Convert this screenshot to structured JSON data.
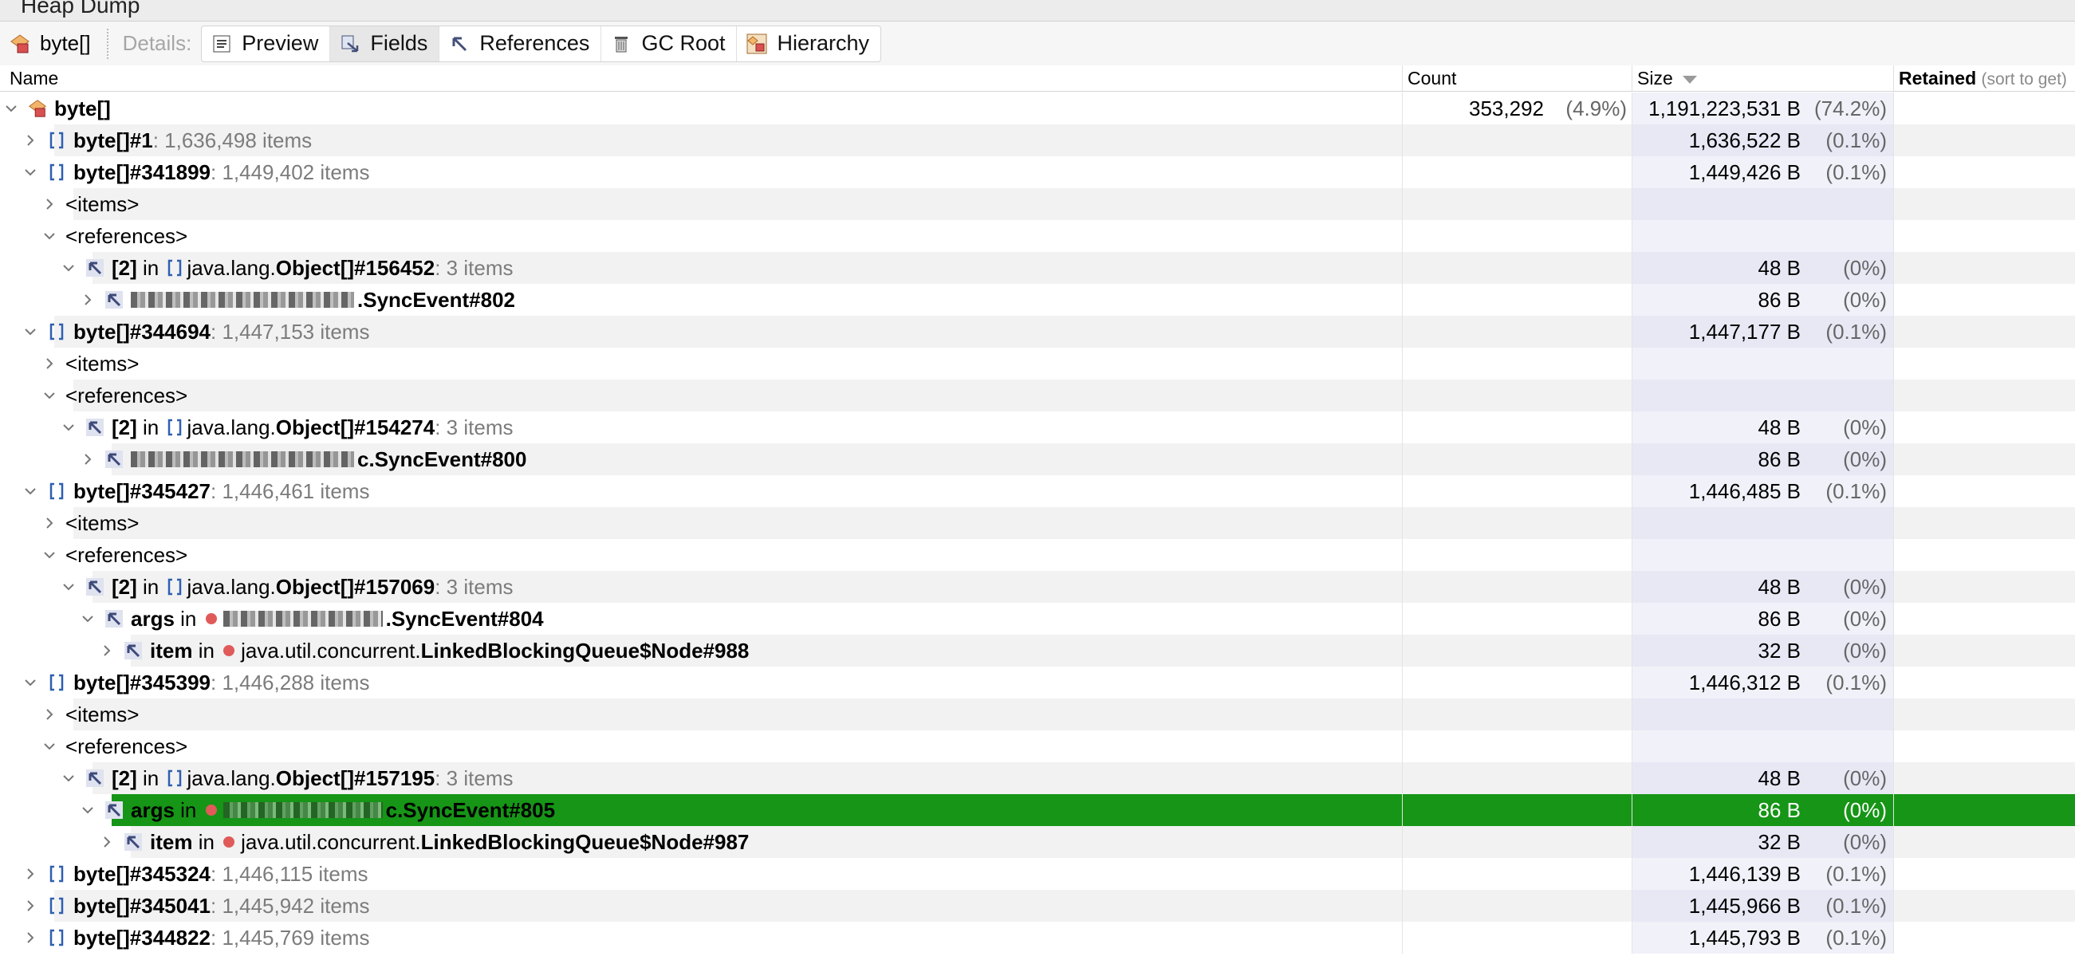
{
  "tab_title": "Heap Dump",
  "toolbar": {
    "object_name": "byte[]",
    "details_label": "Details:",
    "buttons": [
      "Preview",
      "Fields",
      "References",
      "GC Root",
      "Hierarchy"
    ]
  },
  "columns": {
    "name": "Name",
    "count": "Count",
    "size": "Size",
    "retained": "Retained",
    "retained_hint": "(sort to get)"
  },
  "rows": [
    {
      "level": 0,
      "expanded": true,
      "icon": "class",
      "field": "",
      "name": "byte[]",
      "suffix": "",
      "count": "353,292",
      "count_pct": "(4.9%)",
      "size": "1,191,223,531 B",
      "size_pct": "(74.2%)"
    },
    {
      "level": 1,
      "expanded": false,
      "icon": "array",
      "field": "",
      "name": "byte[]#1",
      "suffix": " : 1,636,498 items",
      "size": "1,636,522 B",
      "size_pct": "(0.1%)"
    },
    {
      "level": 1,
      "expanded": true,
      "icon": "array",
      "field": "",
      "name": "byte[]#341899",
      "suffix": " : 1,449,402 items",
      "size": "1,449,426 B",
      "size_pct": "(0.1%)"
    },
    {
      "level": 2,
      "expanded": false,
      "icon": "none",
      "field": "",
      "name": "<items>",
      "suffix": "",
      "size": "",
      "size_pct": ""
    },
    {
      "level": 2,
      "expanded": true,
      "icon": "none",
      "field": "",
      "name": "<references>",
      "suffix": "",
      "size": "",
      "size_pct": ""
    },
    {
      "level": 3,
      "expanded": true,
      "icon": "ref",
      "field": "[2]",
      "in_icon": "array",
      "prefix": "java.lang.",
      "name": "Object[]#156452",
      "suffix": " : 3 items",
      "size": "48 B",
      "size_pct": "(0%)"
    },
    {
      "level": 4,
      "expanded": false,
      "icon": "ref",
      "field": "",
      "blurred": true,
      "name": ".SyncEvent#802",
      "suffix": "",
      "size": "86 B",
      "size_pct": "(0%)"
    },
    {
      "level": 1,
      "expanded": true,
      "icon": "array",
      "field": "",
      "name": "byte[]#344694",
      "suffix": " : 1,447,153 items",
      "size": "1,447,177 B",
      "size_pct": "(0.1%)"
    },
    {
      "level": 2,
      "expanded": false,
      "icon": "none",
      "field": "",
      "name": "<items>",
      "suffix": "",
      "size": "",
      "size_pct": ""
    },
    {
      "level": 2,
      "expanded": true,
      "icon": "none",
      "field": "",
      "name": "<references>",
      "suffix": "",
      "size": "",
      "size_pct": ""
    },
    {
      "level": 3,
      "expanded": true,
      "icon": "ref",
      "field": "[2]",
      "in_icon": "array",
      "prefix": "java.lang.",
      "name": "Object[]#154274",
      "suffix": " : 3 items",
      "size": "48 B",
      "size_pct": "(0%)"
    },
    {
      "level": 4,
      "expanded": false,
      "icon": "ref",
      "field": "",
      "blurred": true,
      "name": "c.SyncEvent#800",
      "suffix": "",
      "size": "86 B",
      "size_pct": "(0%)"
    },
    {
      "level": 1,
      "expanded": true,
      "icon": "array",
      "field": "",
      "name": "byte[]#345427",
      "suffix": " : 1,446,461 items",
      "size": "1,446,485 B",
      "size_pct": "(0.1%)"
    },
    {
      "level": 2,
      "expanded": false,
      "icon": "none",
      "field": "",
      "name": "<items>",
      "suffix": "",
      "size": "",
      "size_pct": ""
    },
    {
      "level": 2,
      "expanded": true,
      "icon": "none",
      "field": "",
      "name": "<references>",
      "suffix": "",
      "size": "",
      "size_pct": ""
    },
    {
      "level": 3,
      "expanded": true,
      "icon": "ref",
      "field": "[2]",
      "in_icon": "array",
      "prefix": "java.lang.",
      "name": "Object[]#157069",
      "suffix": " : 3 items",
      "size": "48 B",
      "size_pct": "(0%)"
    },
    {
      "level": 4,
      "expanded": true,
      "icon": "ref",
      "field": "args",
      "in_icon": "instance",
      "blurred": true,
      "name": ".SyncEvent#804",
      "suffix": "",
      "size": "86 B",
      "size_pct": "(0%)"
    },
    {
      "level": 5,
      "expanded": false,
      "icon": "ref",
      "field": "item",
      "in_icon": "instance",
      "prefix": "java.util.concurrent.",
      "name": "LinkedBlockingQueue$Node#988",
      "suffix": "",
      "size": "32 B",
      "size_pct": "(0%)"
    },
    {
      "level": 1,
      "expanded": true,
      "icon": "array",
      "field": "",
      "name": "byte[]#345399",
      "suffix": " : 1,446,288 items",
      "size": "1,446,312 B",
      "size_pct": "(0.1%)"
    },
    {
      "level": 2,
      "expanded": false,
      "icon": "none",
      "field": "",
      "name": "<items>",
      "suffix": "",
      "size": "",
      "size_pct": ""
    },
    {
      "level": 2,
      "expanded": true,
      "icon": "none",
      "field": "",
      "name": "<references>",
      "suffix": "",
      "size": "",
      "size_pct": ""
    },
    {
      "level": 3,
      "expanded": true,
      "icon": "ref",
      "field": "[2]",
      "in_icon": "array",
      "prefix": "java.lang.",
      "name": "Object[]#157195",
      "suffix": " : 3 items",
      "size": "48 B",
      "size_pct": "(0%)"
    },
    {
      "level": 4,
      "expanded": true,
      "icon": "ref",
      "field": "args",
      "in_icon": "instance",
      "blurred": true,
      "selected": true,
      "name": "c.SyncEvent#805",
      "suffix": "",
      "size": "86 B",
      "size_pct": "(0%)"
    },
    {
      "level": 5,
      "expanded": false,
      "icon": "ref",
      "field": "item",
      "in_icon": "instance",
      "prefix": "java.util.concurrent.",
      "name": "LinkedBlockingQueue$Node#987",
      "suffix": "",
      "size": "32 B",
      "size_pct": "(0%)"
    },
    {
      "level": 1,
      "expanded": false,
      "icon": "array",
      "field": "",
      "name": "byte[]#345324",
      "suffix": " : 1,446,115 items",
      "size": "1,446,139 B",
      "size_pct": "(0.1%)"
    },
    {
      "level": 1,
      "expanded": false,
      "icon": "array",
      "field": "",
      "name": "byte[]#345041",
      "suffix": " : 1,445,942 items",
      "size": "1,445,966 B",
      "size_pct": "(0.1%)"
    },
    {
      "level": 1,
      "expanded": false,
      "icon": "array",
      "field": "",
      "name": "byte[]#344822",
      "suffix": " : 1,445,769 items",
      "size": "1,445,793 B",
      "size_pct": "(0.1%)"
    }
  ],
  "colors": {
    "selection": "#169516",
    "size_column": "#f1f1f9",
    "stripe": "#f2f2f2"
  },
  "icons": {
    "class": "class-icon",
    "array": "array-icon",
    "ref": "reference-arrow-icon",
    "instance": "instance-dot-icon"
  }
}
